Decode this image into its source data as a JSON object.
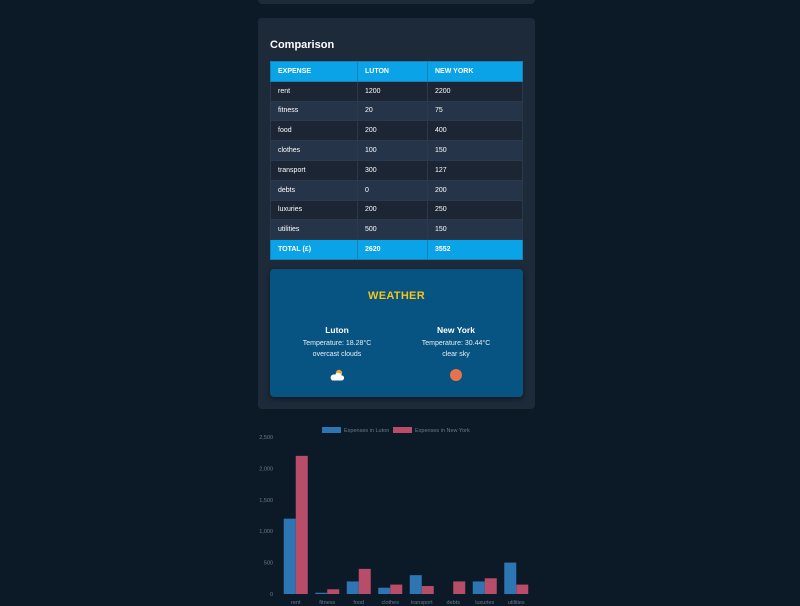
{
  "comparison": {
    "title": "Comparison",
    "headers": [
      "EXPENSE",
      "LUTON",
      "NEW YORK"
    ],
    "rows": [
      [
        "rent",
        "1200",
        "2200"
      ],
      [
        "fitness",
        "20",
        "75"
      ],
      [
        "food",
        "200",
        "400"
      ],
      [
        "clothes",
        "100",
        "150"
      ],
      [
        "transport",
        "300",
        "127"
      ],
      [
        "debts",
        "0",
        "200"
      ],
      [
        "luxuries",
        "200",
        "250"
      ],
      [
        "utilities",
        "500",
        "150"
      ]
    ],
    "total": [
      "TOTAL (£)",
      "2620",
      "3552"
    ]
  },
  "weather": {
    "title": "WEATHER",
    "luton": {
      "name": "Luton",
      "temperature": "Temperature: 18.28°C",
      "description": "overcast clouds",
      "icon": "cloud-sun-icon"
    },
    "new_york": {
      "name": "New York",
      "temperature": "Temperature: 30.44°C",
      "description": "clear sky",
      "icon": "sun-icon"
    }
  },
  "colors": {
    "table_header": "#0ba3e8",
    "weather_bg": "#075483",
    "weather_title": "#f5c518",
    "luton_series": "#2e76b3",
    "new_york_series": "#b84d69"
  },
  "chart_data": {
    "type": "bar",
    "categories": [
      "rent",
      "fitness",
      "food",
      "clothes",
      "transport",
      "debts",
      "luxuries",
      "utilities"
    ],
    "series": [
      {
        "name": "Expenses in Luton",
        "values": [
          1200,
          20,
          200,
          100,
          300,
          0,
          200,
          500
        ]
      },
      {
        "name": "Expenses in New York",
        "values": [
          2200,
          75,
          400,
          150,
          127,
          200,
          250,
          150
        ]
      }
    ],
    "ylim": [
      0,
      2500
    ],
    "yticks": [
      "0",
      "500",
      "1,000",
      "1,500",
      "2,000",
      "2,500"
    ],
    "legend": "top",
    "grid": false
  }
}
